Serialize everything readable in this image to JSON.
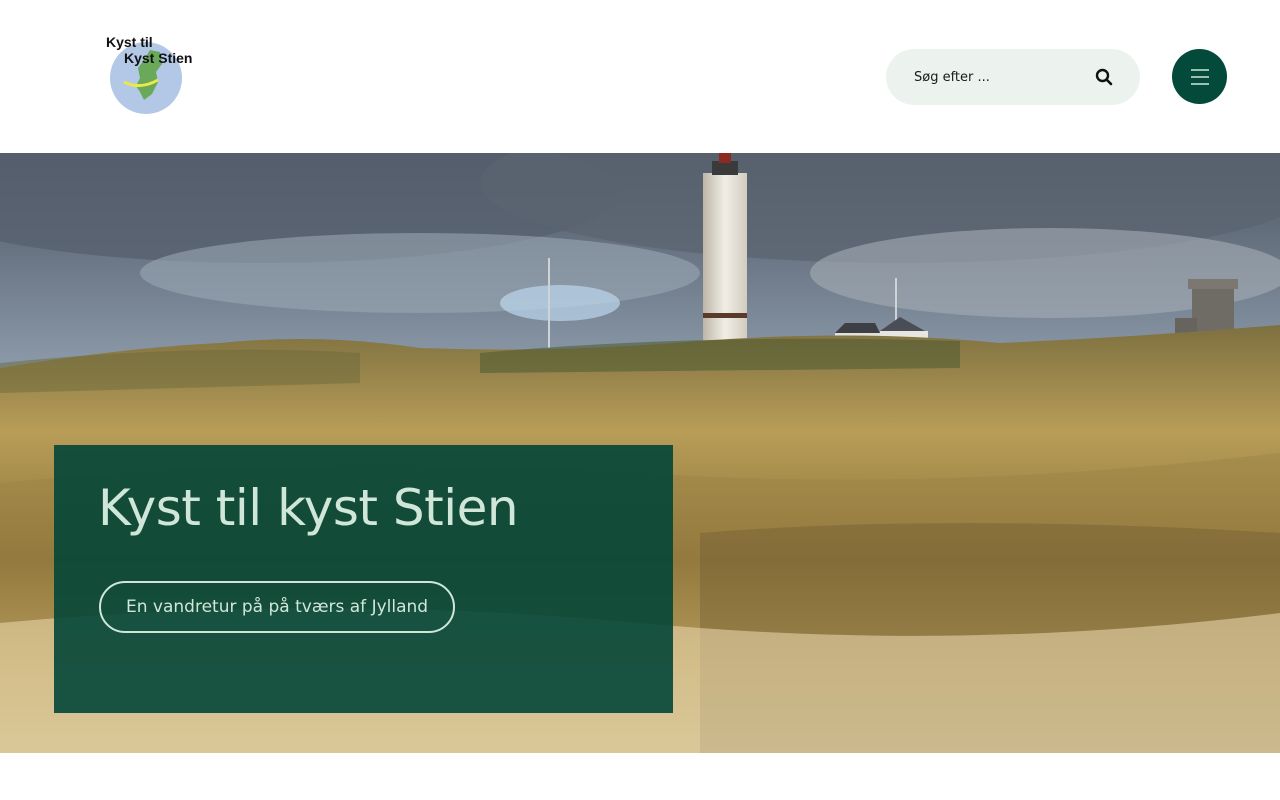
{
  "header": {
    "logo": {
      "line1": "Kyst til",
      "line2": "Kyst Stien",
      "icon": "map-logo"
    },
    "search": {
      "placeholder": "Søg efter ...",
      "value": "",
      "icon": "search-icon"
    },
    "menu": {
      "icon": "hamburger-menu-icon"
    }
  },
  "hero": {
    "title": "Kyst til kyst Stien",
    "button_label": "En vandretur på på tværs af Jylland",
    "image": "lighthouse-dunes-photo"
  },
  "colors": {
    "brand_dark_green": "#034a3b",
    "card_green": "#034637",
    "card_text": "#cfe6d9",
    "search_bg": "#ecf3ef"
  }
}
